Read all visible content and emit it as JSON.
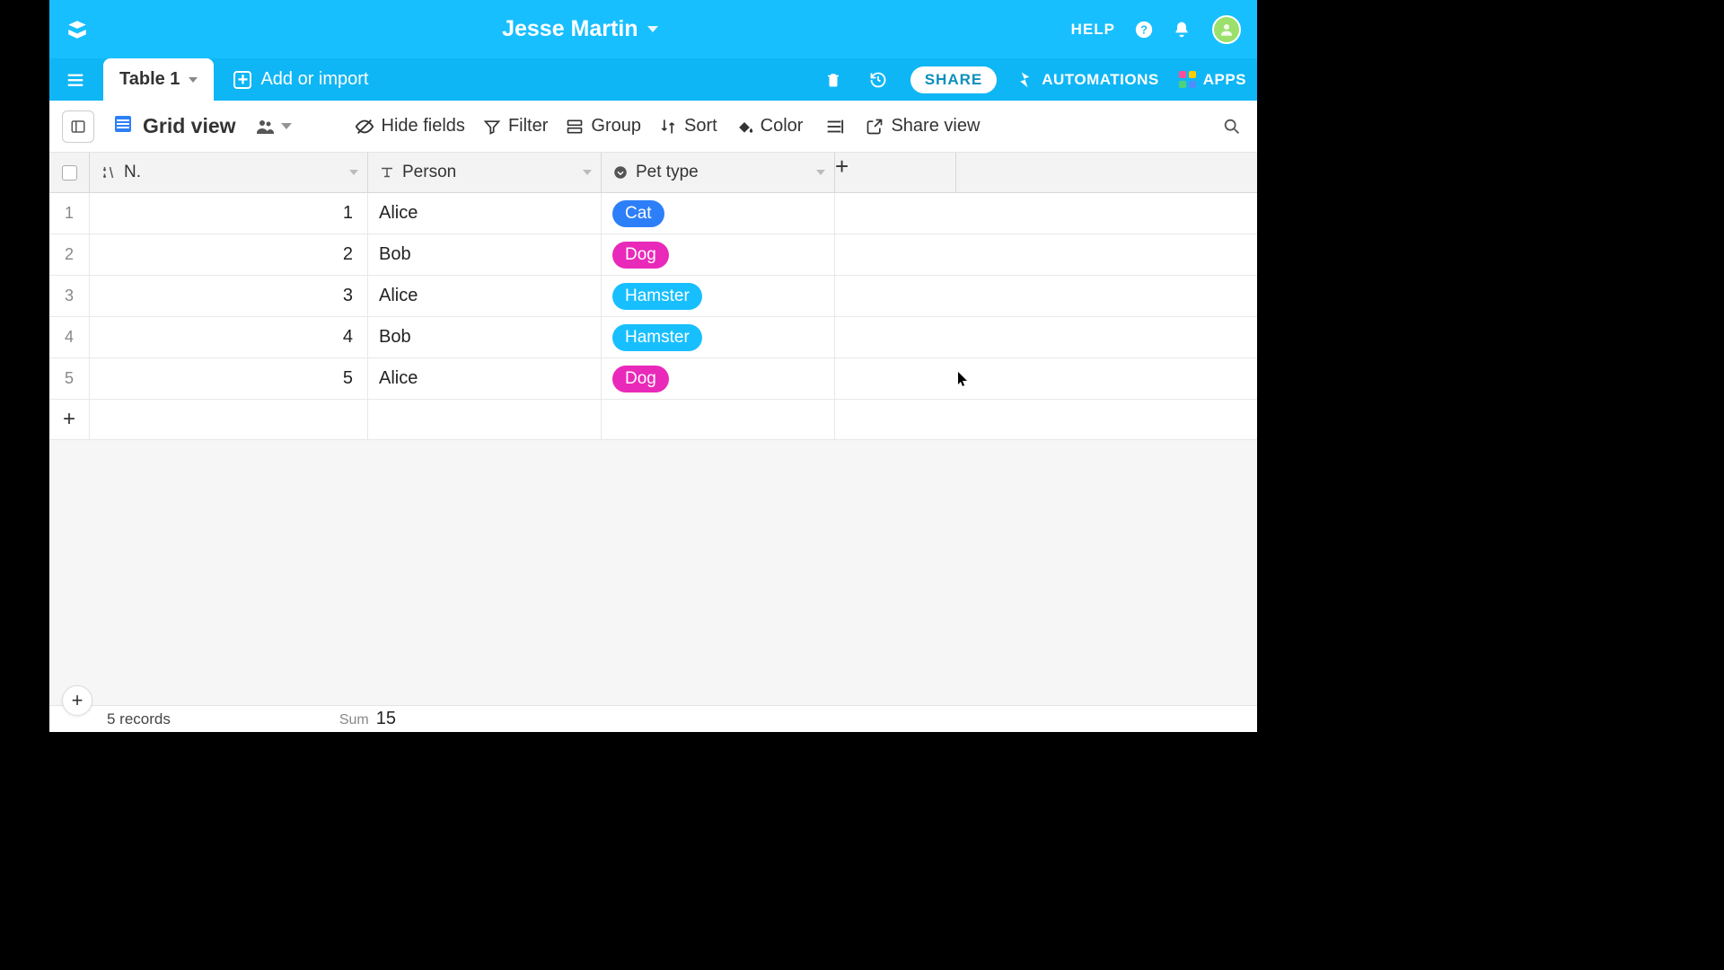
{
  "header": {
    "base_name": "Jesse Martin",
    "help_label": "HELP"
  },
  "tabs": {
    "active_tab": "Table 1",
    "add_import": "Add or import",
    "share": "SHARE",
    "automations": "AUTOMATIONS",
    "apps": "APPS"
  },
  "viewbar": {
    "view_name": "Grid view",
    "hide_fields": "Hide fields",
    "filter": "Filter",
    "group": "Group",
    "sort": "Sort",
    "color": "Color",
    "share_view": "Share view"
  },
  "columns": {
    "n": "N.",
    "person": "Person",
    "pet_type": "Pet type"
  },
  "rows": [
    {
      "idx": "1",
      "n": "1",
      "person": "Alice",
      "pet": "Cat",
      "pet_class": "tag-cat"
    },
    {
      "idx": "2",
      "n": "2",
      "person": "Bob",
      "pet": "Dog",
      "pet_class": "tag-dog"
    },
    {
      "idx": "3",
      "n": "3",
      "person": "Alice",
      "pet": "Hamster",
      "pet_class": "tag-hamster"
    },
    {
      "idx": "4",
      "n": "4",
      "person": "Bob",
      "pet": "Hamster",
      "pet_class": "tag-hamster"
    },
    {
      "idx": "5",
      "n": "5",
      "person": "Alice",
      "pet": "Dog",
      "pet_class": "tag-dog"
    }
  ],
  "footer": {
    "record_count": "5 records",
    "sum_label": "Sum",
    "sum_value": "15"
  }
}
